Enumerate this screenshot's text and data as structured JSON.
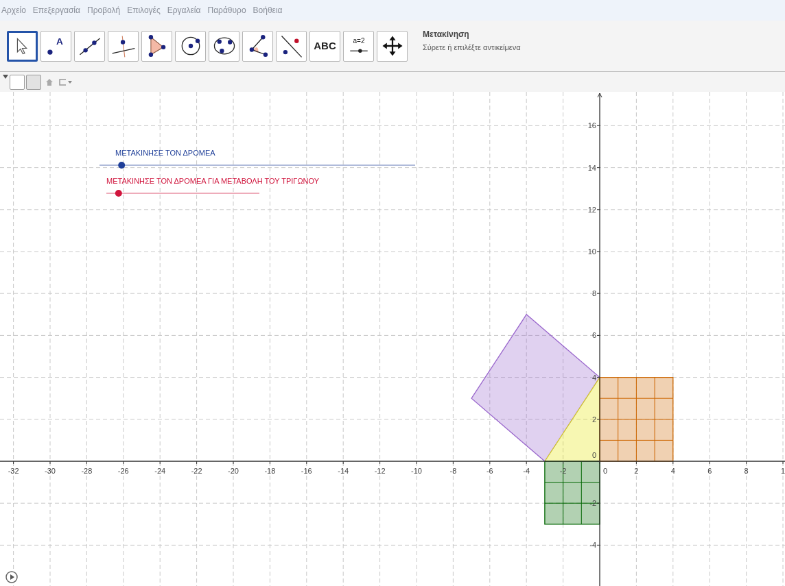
{
  "menu": [
    "Αρχείο",
    "Επεξεργασία",
    "Προβολή",
    "Επιλογές",
    "Εργαλεία",
    "Παράθυρο",
    "Βοήθεια"
  ],
  "tools": [
    {
      "kind": "move",
      "selected": true
    },
    {
      "kind": "point",
      "label": "A",
      "selected": false
    },
    {
      "kind": "line",
      "selected": false
    },
    {
      "kind": "perpendicular",
      "selected": false
    },
    {
      "kind": "polygon",
      "selected": false
    },
    {
      "kind": "circle",
      "selected": false
    },
    {
      "kind": "conic",
      "selected": false
    },
    {
      "kind": "angle",
      "selected": false
    },
    {
      "kind": "reflect",
      "selected": false
    },
    {
      "kind": "text",
      "label": "ABC",
      "selected": false
    },
    {
      "kind": "slider",
      "label": "a=2",
      "selected": false
    },
    {
      "kind": "pan",
      "selected": false
    }
  ],
  "tool_info": {
    "name": "Μετακίνηση",
    "hint": "Σύρετε ή επιλέξτε αντικείμενα"
  },
  "sliders": [
    {
      "label": "ΜΕΤΑΚΙΝΗΣΕ ΤΟΝ ΔΡΟΜΕΑ",
      "color": "#1f3f99",
      "level": 0.07
    },
    {
      "label": "ΜΕΤΑΚΙΝΗΣΕ ΤΟΝ ΔΡΟΜΕΑ ΓΙΑ ΜΕΤΑΒΟΛΗ ΤΟΥ ΤΡΙΓΩΝΟΥ",
      "color": "#d0143c",
      "level": 0.08
    }
  ],
  "x_axis_labels": [
    "-32",
    "-30",
    "-28",
    "-26",
    "-24",
    "-22",
    "-20",
    "-18",
    "-16",
    "-14",
    "-12",
    "-10",
    "-8",
    "-6",
    "-4",
    "-2",
    "0",
    "2",
    "4",
    "6",
    "8",
    "1"
  ],
  "y_axis_labels": [
    "16",
    "14",
    "12",
    "10",
    "8",
    "6",
    "4",
    "2",
    "0",
    "-2",
    "-4"
  ],
  "polygons": [
    {
      "kind": "square",
      "color": "#9966cc"
    },
    {
      "kind": "triangle",
      "color": "#e6e600"
    },
    {
      "kind": "grid-square",
      "color": "#cc6600"
    },
    {
      "kind": "grid-square",
      "color": "#006600"
    }
  ]
}
